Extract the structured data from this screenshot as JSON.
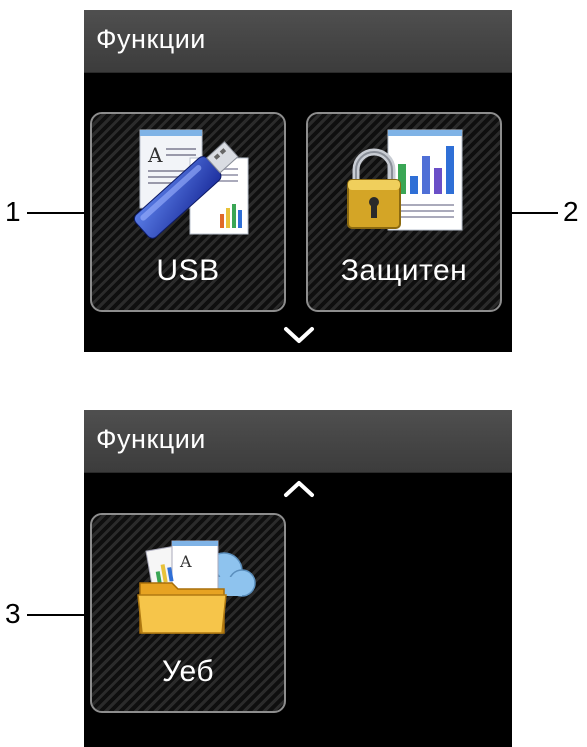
{
  "screens": [
    {
      "title": "Функции",
      "tiles": [
        {
          "label": "USB",
          "icon": "usb-flash-drive-icon"
        },
        {
          "label": "Защитен",
          "icon": "padlock-document-icon"
        }
      ],
      "scroll_icon": "chevron-down-icon"
    },
    {
      "title": "Функции",
      "tiles": [
        {
          "label": "Уеб",
          "icon": "cloud-folder-icon"
        }
      ],
      "scroll_icon": "chevron-up-icon"
    }
  ],
  "callouts": [
    "1",
    "2",
    "3"
  ]
}
